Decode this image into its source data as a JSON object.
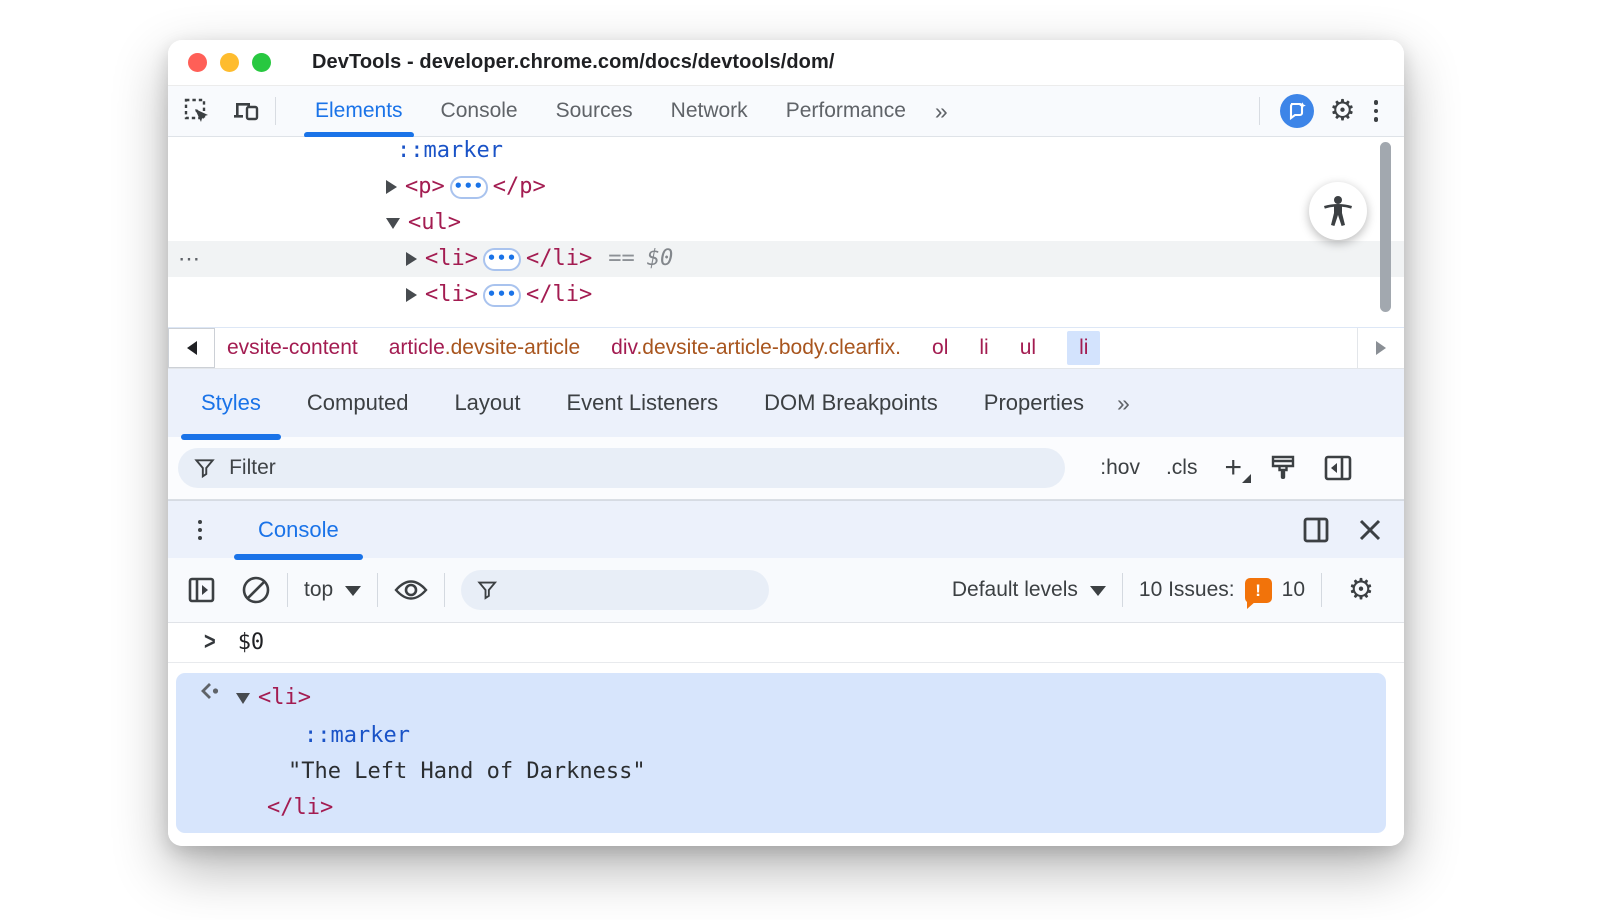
{
  "titlebar": {
    "title": "DevTools - developer.chrome.com/docs/devtools/dom/"
  },
  "main_toolbar": {
    "tabs": [
      {
        "label": "Elements"
      },
      {
        "label": "Console"
      },
      {
        "label": "Sources"
      },
      {
        "label": "Network"
      },
      {
        "label": "Performance"
      }
    ],
    "more": "»"
  },
  "dom_tree": {
    "gutter_dots": "⋯",
    "rows": [
      {
        "pseudo": "::marker"
      },
      {
        "open": "<p>",
        "close": "</p>"
      },
      {
        "open": "<ul>"
      },
      {
        "open": "<li>",
        "close": "</li>",
        "eq": "==",
        "dollar": "$0"
      },
      {
        "open": "<li>",
        "close": "</li>"
      }
    ]
  },
  "breadcrumbs": {
    "items": [
      {
        "tag": "evsite-content"
      },
      {
        "tag": "article",
        "cls": ".devsite-article"
      },
      {
        "tag": "div",
        "cls": ".devsite-article-body.clearfix."
      },
      {
        "tag": "ol"
      },
      {
        "tag": "li"
      },
      {
        "tag": "ul"
      },
      {
        "tag": "li"
      }
    ]
  },
  "styles_panel": {
    "tabs": [
      {
        "label": "Styles"
      },
      {
        "label": "Computed"
      },
      {
        "label": "Layout"
      },
      {
        "label": "Event Listeners"
      },
      {
        "label": "DOM Breakpoints"
      },
      {
        "label": "Properties"
      }
    ],
    "more": "»",
    "filter_placeholder": "Filter",
    "hov": ":hov",
    "cls": ".cls",
    "plus": "+"
  },
  "console_drawer": {
    "tab": "Console",
    "context_selector": "top",
    "default_levels": "Default levels",
    "issues_label": "10 Issues:",
    "issues_count": "10",
    "prompt_chevron": ">",
    "command": "$0",
    "result": {
      "open_tag": "<li>",
      "marker": "::marker",
      "text": "\"The Left Hand of Darkness\"",
      "close_tag": "</li>"
    }
  },
  "colors": {
    "accent_blue": "#1a73e8",
    "code_blue": "#1a53c7",
    "tag_color": "#a31c51",
    "class_color": "#a8551e",
    "issues_orange": "#f2730a",
    "selection_blue": "#d7e5fc"
  }
}
